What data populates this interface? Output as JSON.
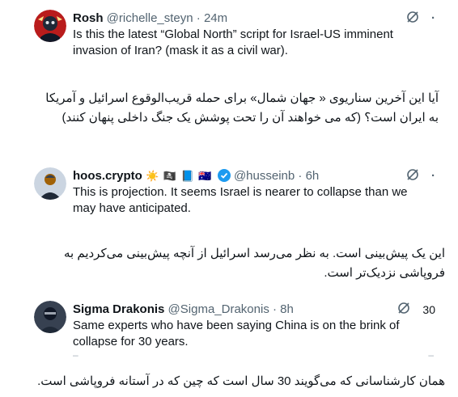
{
  "tweets": [
    {
      "name": "Rosh",
      "handle": "@richelle_steyn",
      "time": "24m",
      "text": "Is this the latest “Global North” script for Israel-US imminent invasion of Iran? (mask it as a civil war).",
      "translation": "آیا این آخرین سناریوی « جهان شمال» برای حمله قریب‌الوقوع اسرائیل و آمریکا به ایران است؟ (که می خواهند آن را تحت پوشش یک جنگ داخلی پنهان کنند)"
    },
    {
      "name": "hoos.crypto",
      "emojis": "☀️ 🏴‍☠️ 📘 🇦🇺",
      "handle": "@husseinb",
      "time": "6h",
      "text": "This is projection. It seems Israel is nearer to collapse than we may have anticipated.",
      "translation": "این یک پیش‌بینی است. به نظر می‌رسد اسرائیل از آنچه پیش‌بینی می‌کردیم به فروپاشی نزدیک‌تر است."
    },
    {
      "name": "Sigma Drakonis",
      "handle": "@Sigma_Drakonis",
      "time": "8h",
      "views": "30",
      "text": "Same experts who have been saying China is on the brink of collapse for 30 years.",
      "translation": "همان کارشناسانی که می‌گویند 30 سال است که چین که در آستانه فروپاشی است."
    }
  ],
  "separator": "·",
  "colors": {
    "text": "#0f1419",
    "secondary": "#536471",
    "verified": "#1d9bf0",
    "avatar1": "#b91c1c"
  }
}
